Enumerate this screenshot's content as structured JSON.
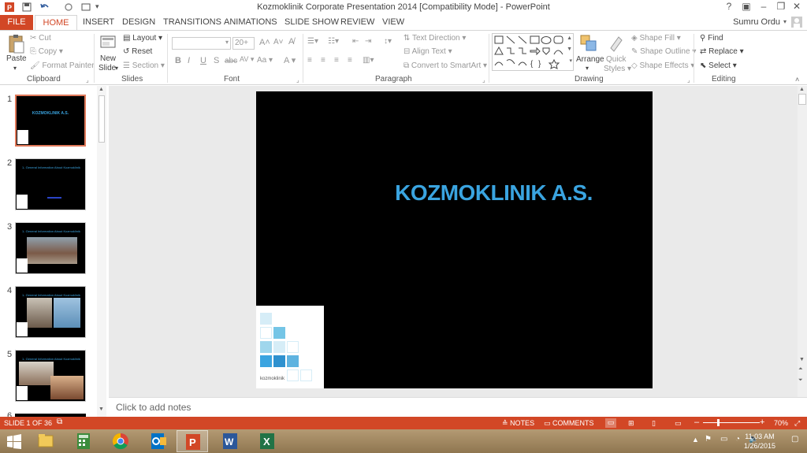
{
  "window": {
    "title": "Kozmoklinik Corporate Presentation 2014 [Compatibility Mode] - PowerPoint",
    "help": "?"
  },
  "tabs": {
    "file": "FILE",
    "items": [
      "HOME",
      "INSERT",
      "DESIGN",
      "TRANSITIONS",
      "ANIMATIONS",
      "SLIDE SHOW",
      "REVIEW",
      "VIEW"
    ],
    "user": "Sumru Ordu"
  },
  "ribbon": {
    "clipboard": {
      "paste": "Paste",
      "cut": "Cut",
      "copy": "Copy",
      "format_painter": "Format Painter",
      "label": "Clipboard"
    },
    "slides": {
      "new_slide": "New",
      "new_slide2": "Slide",
      "layout": "Layout",
      "reset": "Reset",
      "section": "Section",
      "label": "Slides"
    },
    "font": {
      "size": "20+",
      "label": "Font",
      "aa": "Aa"
    },
    "paragraph": {
      "text_direction": "Text Direction",
      "align_text": "Align Text",
      "smartart": "Convert to SmartArt",
      "label": "Paragraph"
    },
    "drawing": {
      "arrange": "Arrange",
      "quick_styles": "Quick",
      "quick_styles2": "Styles",
      "shape_fill": "Shape Fill",
      "shape_outline": "Shape Outline",
      "shape_effects": "Shape Effects",
      "label": "Drawing"
    },
    "editing": {
      "find": "Find",
      "replace": "Replace",
      "select": "Select",
      "label": "Editing"
    }
  },
  "thumbnails": [
    {
      "num": "1",
      "title": "KOZMOKLINIK A.S."
    },
    {
      "num": "2",
      "title": "1- General Information About Kozmoklinik"
    },
    {
      "num": "3",
      "title": "1- General Information About Kozmoklinik"
    },
    {
      "num": "4",
      "title": "1- General Information About Kozmoklinik"
    },
    {
      "num": "5",
      "title": "1- General Information About Kozmoklinik"
    },
    {
      "num": "6",
      "title": ""
    }
  ],
  "slide": {
    "title": "KOZMOKLINIK A.S.",
    "logo_text": "kozmoklinik"
  },
  "notes": {
    "placeholder": "Click to add notes"
  },
  "status": {
    "slide_of": "SLIDE 1 OF 36",
    "notes": "NOTES",
    "comments": "COMMENTS",
    "zoom": "70%"
  },
  "taskbar": {
    "time": "11:03 AM",
    "date": "1/26/2015"
  },
  "colors": {
    "accent": "#d24726",
    "title_blue": "#3aa4e0"
  }
}
